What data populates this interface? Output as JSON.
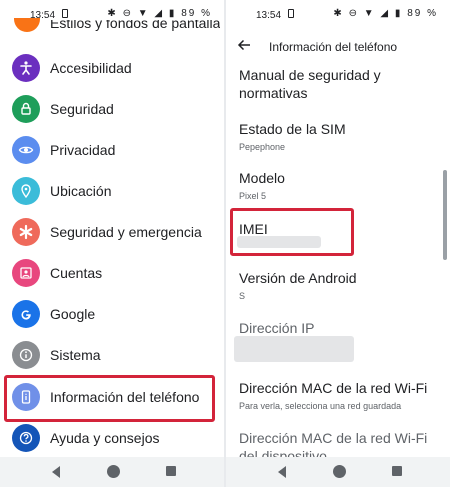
{
  "status_bar": {
    "time": "13:54",
    "battery": "89 %",
    "icons": [
      "bluetooth-icon",
      "dnd-icon",
      "wifi-icon",
      "signal-icon"
    ]
  },
  "left": {
    "cut_off_item": "Estilos y fondos de pantalla",
    "items": [
      {
        "label": "Accesibilidad",
        "icon": "accessibility-icon",
        "color": "#6b2fbf"
      },
      {
        "label": "Seguridad",
        "icon": "lock-icon",
        "color": "#1e9e5a"
      },
      {
        "label": "Privacidad",
        "icon": "eye-icon",
        "color": "#5b8def"
      },
      {
        "label": "Ubicación",
        "icon": "location-pin-icon",
        "color": "#3bbcd9"
      },
      {
        "label": "Seguridad y emergencia",
        "icon": "asterisk-icon",
        "color": "#ef6a5b"
      },
      {
        "label": "Cuentas",
        "icon": "account-box-icon",
        "color": "#e8477e"
      },
      {
        "label": "Google",
        "icon": "google-g-icon",
        "color": "#1a73e8"
      },
      {
        "label": "Sistema",
        "icon": "info-icon",
        "color": "#8a8d91"
      },
      {
        "label": "Información del teléfono",
        "icon": "phone-info-icon",
        "color": "#7090e8"
      },
      {
        "label": "Ayuda y consejos",
        "icon": "help-icon",
        "color": "#1455b8"
      }
    ]
  },
  "right": {
    "title": "Información del teléfono",
    "items": [
      {
        "title": "Manual de seguridad y normativas",
        "subtitle": ""
      },
      {
        "title": "Estado de la SIM",
        "subtitle": "Pepephone"
      },
      {
        "title": "Modelo",
        "subtitle": "Pixel 5"
      },
      {
        "title": "IMEI",
        "subtitle": ""
      },
      {
        "title": "Versión de Android",
        "subtitle": "S"
      },
      {
        "title": "Dirección IP",
        "subtitle": ""
      },
      {
        "title": "Dirección MAC de la red Wi-Fi",
        "subtitle": "Para verla, selecciona una red guardada"
      },
      {
        "title": "Dirección MAC de la red Wi-Fi del dispositivo",
        "subtitle": ""
      }
    ]
  },
  "colors": {
    "highlight": "#d3243a",
    "nav_bar": "#f1f3f4"
  }
}
